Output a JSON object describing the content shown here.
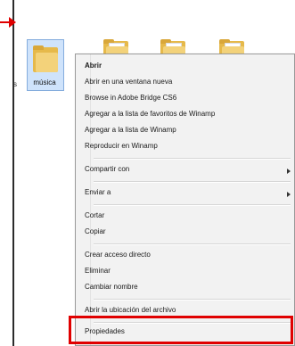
{
  "folder": {
    "name": "música"
  },
  "left_fragment": "s",
  "menu": {
    "items": [
      "Abrir",
      "Abrir en una ventana nueva",
      "Browse in Adobe Bridge CS6",
      "Agregar a la lista de favoritos de Winamp",
      "Agregar a la lista de Winamp",
      "Reproducir en Winamp",
      "Compartir con",
      "Enviar a",
      "Cortar",
      "Copiar",
      "Crear acceso directo",
      "Eliminar",
      "Cambiar nombre",
      "Abrir la ubicación del archivo",
      "Propiedades"
    ]
  },
  "colors": {
    "highlight": "#e00000",
    "selection": "#cfe3fb"
  }
}
